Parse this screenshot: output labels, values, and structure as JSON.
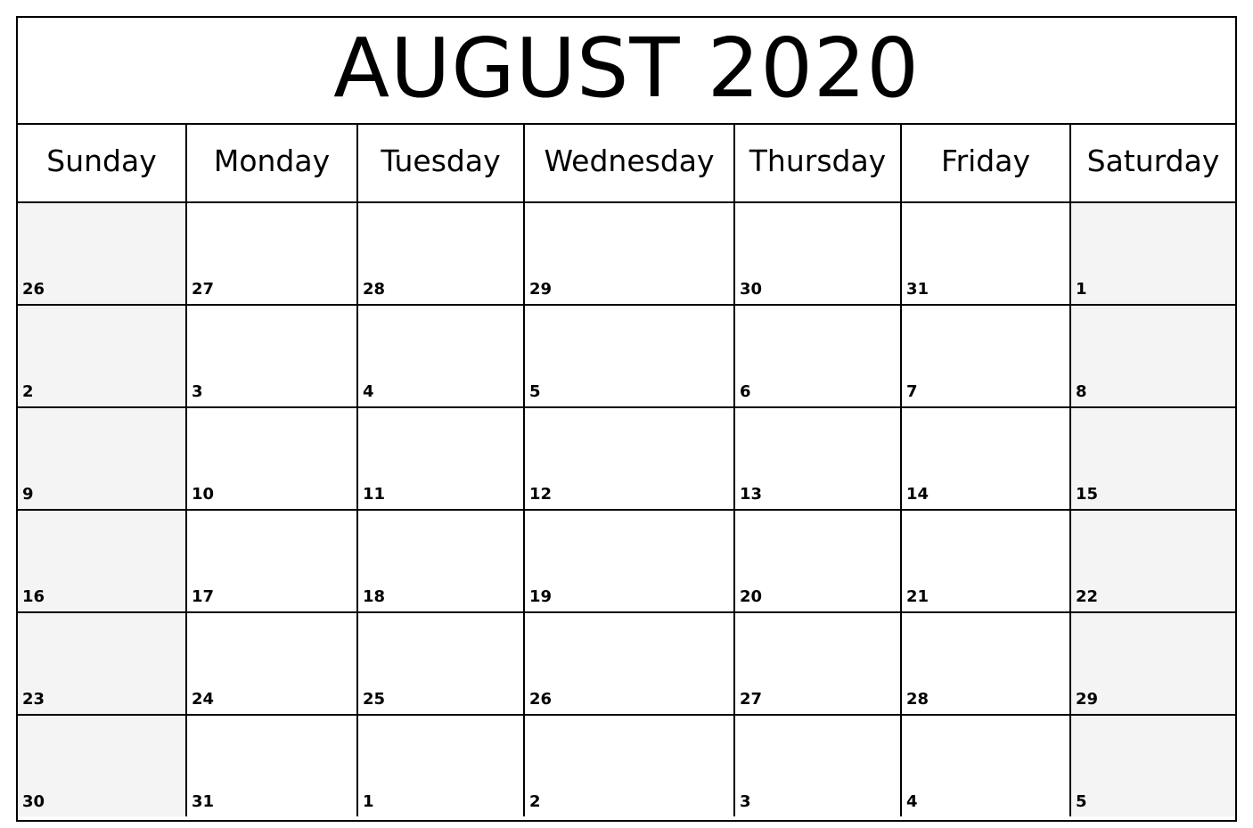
{
  "calendar": {
    "title": "AUGUST 2020",
    "month": "AUGUST",
    "year": "2020",
    "weekday_headers": [
      "Sunday",
      "Monday",
      "Tuesday",
      "Wednesday",
      "Thursday",
      "Friday",
      "Saturday"
    ],
    "weeks": [
      [
        {
          "day": "26",
          "in_month": false,
          "weekend": true
        },
        {
          "day": "27",
          "in_month": false,
          "weekend": false
        },
        {
          "day": "28",
          "in_month": false,
          "weekend": false
        },
        {
          "day": "29",
          "in_month": false,
          "weekend": false
        },
        {
          "day": "30",
          "in_month": false,
          "weekend": false
        },
        {
          "day": "31",
          "in_month": false,
          "weekend": false
        },
        {
          "day": "1",
          "in_month": true,
          "weekend": true
        }
      ],
      [
        {
          "day": "2",
          "in_month": true,
          "weekend": true
        },
        {
          "day": "3",
          "in_month": true,
          "weekend": false
        },
        {
          "day": "4",
          "in_month": true,
          "weekend": false
        },
        {
          "day": "5",
          "in_month": true,
          "weekend": false
        },
        {
          "day": "6",
          "in_month": true,
          "weekend": false
        },
        {
          "day": "7",
          "in_month": true,
          "weekend": false
        },
        {
          "day": "8",
          "in_month": true,
          "weekend": true
        }
      ],
      [
        {
          "day": "9",
          "in_month": true,
          "weekend": true
        },
        {
          "day": "10",
          "in_month": true,
          "weekend": false
        },
        {
          "day": "11",
          "in_month": true,
          "weekend": false
        },
        {
          "day": "12",
          "in_month": true,
          "weekend": false
        },
        {
          "day": "13",
          "in_month": true,
          "weekend": false
        },
        {
          "day": "14",
          "in_month": true,
          "weekend": false
        },
        {
          "day": "15",
          "in_month": true,
          "weekend": true
        }
      ],
      [
        {
          "day": "16",
          "in_month": true,
          "weekend": true
        },
        {
          "day": "17",
          "in_month": true,
          "weekend": false
        },
        {
          "day": "18",
          "in_month": true,
          "weekend": false
        },
        {
          "day": "19",
          "in_month": true,
          "weekend": false
        },
        {
          "day": "20",
          "in_month": true,
          "weekend": false
        },
        {
          "day": "21",
          "in_month": true,
          "weekend": false
        },
        {
          "day": "22",
          "in_month": true,
          "weekend": true
        }
      ],
      [
        {
          "day": "23",
          "in_month": true,
          "weekend": true
        },
        {
          "day": "24",
          "in_month": true,
          "weekend": false
        },
        {
          "day": "25",
          "in_month": true,
          "weekend": false
        },
        {
          "day": "26",
          "in_month": true,
          "weekend": false
        },
        {
          "day": "27",
          "in_month": true,
          "weekend": false
        },
        {
          "day": "28",
          "in_month": true,
          "weekend": false
        },
        {
          "day": "29",
          "in_month": true,
          "weekend": true
        }
      ],
      [
        {
          "day": "30",
          "in_month": true,
          "weekend": true
        },
        {
          "day": "31",
          "in_month": true,
          "weekend": false
        },
        {
          "day": "1",
          "in_month": false,
          "weekend": false
        },
        {
          "day": "2",
          "in_month": false,
          "weekend": false
        },
        {
          "day": "3",
          "in_month": false,
          "weekend": false
        },
        {
          "day": "4",
          "in_month": false,
          "weekend": false
        },
        {
          "day": "5",
          "in_month": false,
          "weekend": true
        }
      ]
    ],
    "colors": {
      "grid_line": "#000000",
      "weekend_background": "#f4f4f4",
      "weekday_background": "#ffffff",
      "text": "#000000",
      "page_background": "#ffffff"
    }
  }
}
